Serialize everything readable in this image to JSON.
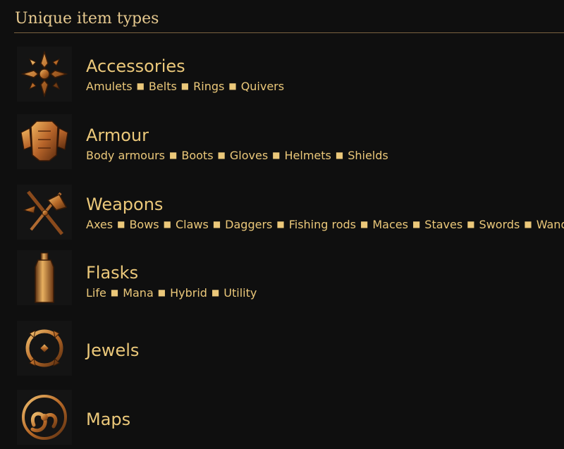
{
  "section": {
    "title": "Unique item types"
  },
  "categories": [
    {
      "title": "Accessories",
      "icon": "accessories-icon",
      "links": [
        "Amulets",
        "Belts",
        "Rings",
        "Quivers"
      ]
    },
    {
      "title": "Armour",
      "icon": "armour-icon",
      "links": [
        "Body armours",
        "Boots",
        "Gloves",
        "Helmets",
        "Shields"
      ]
    },
    {
      "title": "Weapons",
      "icon": "weapons-icon",
      "links": [
        "Axes",
        "Bows",
        "Claws",
        "Daggers",
        "Fishing rods",
        "Maces",
        "Staves",
        "Swords",
        "Wands"
      ]
    },
    {
      "title": "Flasks",
      "icon": "flask-icon",
      "links": [
        "Life",
        "Mana",
        "Hybrid",
        "Utility"
      ]
    },
    {
      "title": "Jewels",
      "icon": "jewel-icon",
      "links": []
    },
    {
      "title": "Maps",
      "icon": "map-icon",
      "links": []
    }
  ],
  "colors": {
    "background": "#0f0f0f",
    "text": "#ebc87a",
    "rule": "#7a6240",
    "icon_gold": "#c8843a"
  }
}
